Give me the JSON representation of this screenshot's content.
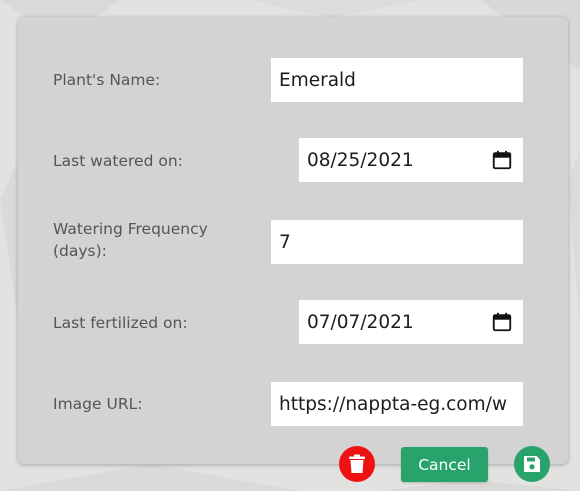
{
  "form": {
    "name_label": "Plant's Name:",
    "name_value": "Emerald",
    "watered_label": "Last watered on:",
    "watered_value": "08/25/2021",
    "frequency_label": "Watering Frequency (days):",
    "frequency_value": "7",
    "fertilized_label": "Last fertilized on:",
    "fertilized_value": "07/07/2021",
    "image_label": "Image URL:",
    "image_value": "https://nappta-eg.com/w"
  },
  "actions": {
    "cancel_label": "Cancel",
    "delete_icon": "trash-icon",
    "save_icon": "floppy-disk-icon"
  },
  "colors": {
    "card": "#d3d3d3",
    "delete": "#ee1212",
    "accent": "#27a36b",
    "label_text": "#555555"
  }
}
